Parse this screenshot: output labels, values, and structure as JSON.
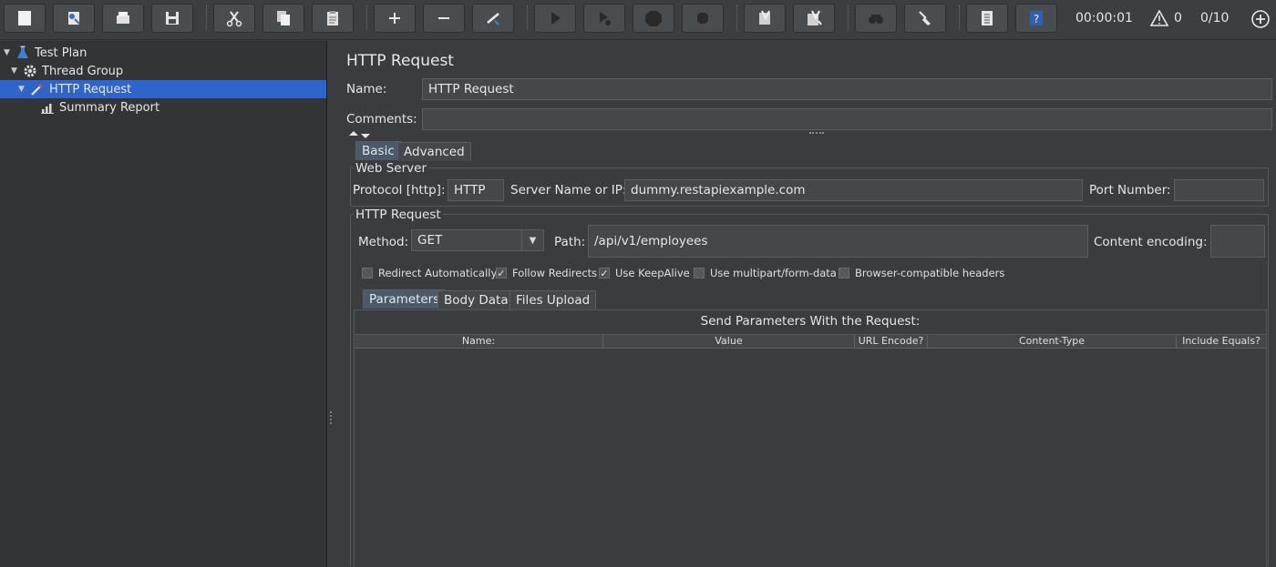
{
  "toolbar": {
    "timer": "00:00:01",
    "warning_count": "0",
    "threads": "0/10",
    "buttons": [
      "new-icon",
      "templates-icon",
      "open-icon",
      "save-icon",
      "cut-icon",
      "copy-icon",
      "paste-icon",
      "expand-icon",
      "collapse-icon",
      "toggle-icon",
      "start-icon",
      "start-no-pause-icon",
      "stop-icon",
      "shutdown-icon",
      "clear-icon",
      "clear-all-icon",
      "search-icon",
      "reset-search-icon",
      "function-helper-icon",
      "help-icon"
    ]
  },
  "tree": {
    "items": [
      {
        "label": "Test Plan"
      },
      {
        "label": "Thread Group"
      },
      {
        "label": "HTTP Request"
      },
      {
        "label": "Summary Report"
      }
    ]
  },
  "main": {
    "title": "HTTP Request",
    "name_label": "Name:",
    "name_value": "HTTP Request",
    "comments_label": "Comments:",
    "comments_value": "",
    "tabs": [
      {
        "label": "Basic"
      },
      {
        "label": "Advanced"
      }
    ],
    "web_server": {
      "title": "Web Server",
      "protocol_label": "Protocol [http]:",
      "protocol_value": "HTTP",
      "server_label": "Server Name or IP:",
      "server_value": "dummy.restapiexample.com",
      "port_label": "Port Number:",
      "port_value": ""
    },
    "http_request": {
      "title": "HTTP Request",
      "method_label": "Method:",
      "method_value": "GET",
      "path_label": "Path:",
      "path_value": "/api/v1/employees",
      "encoding_label": "Content encoding:",
      "encoding_value": "",
      "checkboxes": [
        {
          "label": "Redirect Automatically",
          "checked": false
        },
        {
          "label": "Follow Redirects",
          "checked": true
        },
        {
          "label": "Use KeepAlive",
          "checked": true
        },
        {
          "label": "Use multipart/form-data",
          "checked": false
        },
        {
          "label": "Browser-compatible headers",
          "checked": false
        }
      ]
    },
    "sub_tabs": [
      {
        "label": "Parameters"
      },
      {
        "label": "Body Data"
      },
      {
        "label": "Files Upload"
      }
    ],
    "params_table": {
      "caption": "Send Parameters With the Request:",
      "columns": [
        "Name:",
        "Value",
        "URL Encode?",
        "Content-Type",
        "Include Equals?"
      ]
    }
  }
}
